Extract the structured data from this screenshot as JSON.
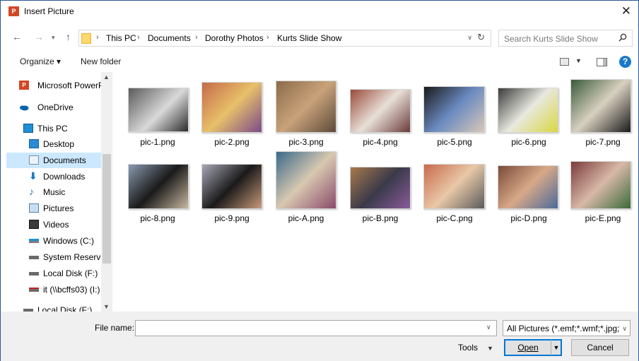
{
  "window": {
    "title": "Insert Picture",
    "app_icon_text": "P"
  },
  "address": {
    "crumbs": [
      "This PC",
      "Documents",
      "Dorothy Photos",
      "Kurts Slide Show"
    ],
    "separator": "›"
  },
  "search": {
    "placeholder": "Search Kurts Slide Show"
  },
  "toolbar": {
    "organize_label": "Organize ▾",
    "new_folder_label": "New folder"
  },
  "nav": {
    "items": [
      {
        "label": "Microsoft PowerP",
        "icon": "powerpoint-icon"
      },
      {
        "label": "OneDrive",
        "icon": "onedrive-icon"
      },
      {
        "label": "This PC",
        "icon": "computer-icon"
      },
      {
        "label": "Desktop",
        "icon": "desktop-icon"
      },
      {
        "label": "Documents",
        "icon": "documents-icon",
        "selected": true
      },
      {
        "label": "Downloads",
        "icon": "downloads-icon"
      },
      {
        "label": "Music",
        "icon": "music-icon"
      },
      {
        "label": "Pictures",
        "icon": "pictures-icon"
      },
      {
        "label": "Videos",
        "icon": "videos-icon"
      },
      {
        "label": "Windows (C:)",
        "icon": "drive-icon"
      },
      {
        "label": "System Reserved",
        "icon": "drive-icon"
      },
      {
        "label": "Local Disk (F:)",
        "icon": "drive-icon"
      },
      {
        "label": "it (\\\\bcffs03) (I:)",
        "icon": "network-drive-icon"
      },
      {
        "label": "Local Disk (F:)",
        "icon": "drive-icon"
      }
    ]
  },
  "files": [
    {
      "name": "pic-1.png",
      "colors": [
        "#5a5a5a",
        "#d9d9d9",
        "#2b2b2b"
      ]
    },
    {
      "name": "pic-2.png",
      "colors": [
        "#c46a4a",
        "#e8c06a",
        "#7a4a8a"
      ]
    },
    {
      "name": "pic-3.png",
      "colors": [
        "#8b6b4a",
        "#c9a27a",
        "#5d4a3a"
      ]
    },
    {
      "name": "pic-4.png",
      "colors": [
        "#9a4a3a",
        "#e8e0d8",
        "#6a3a3a"
      ]
    },
    {
      "name": "pic-5.png",
      "colors": [
        "#1a1a1a",
        "#6a8ac0",
        "#d8c8b8"
      ]
    },
    {
      "name": "pic-6.png",
      "colors": [
        "#3a3a3a",
        "#e8e8e0",
        "#d8d840"
      ]
    },
    {
      "name": "pic-7.png",
      "colors": [
        "#3a5a3a",
        "#d8d0c0",
        "#1a1a1a"
      ]
    },
    {
      "name": "pic-8.png",
      "colors": [
        "#8a9ab0",
        "#1a1a1a",
        "#c8b8a0"
      ]
    },
    {
      "name": "pic-9.png",
      "colors": [
        "#a8a8b8",
        "#1a1a1a",
        "#c89a7a"
      ]
    },
    {
      "name": "pic-A.png",
      "colors": [
        "#3a6a8a",
        "#d8c8b0",
        "#8a4a6a"
      ]
    },
    {
      "name": "pic-B.png",
      "colors": [
        "#a87a4a",
        "#3a3a4a",
        "#8a5a9a"
      ]
    },
    {
      "name": "pic-C.png",
      "colors": [
        "#c86a4a",
        "#e8c8a8",
        "#5a5a5a"
      ]
    },
    {
      "name": "pic-D.png",
      "colors": [
        "#7a4a3a",
        "#d8a888",
        "#4a6a9a"
      ]
    },
    {
      "name": "pic-E.png",
      "colors": [
        "#7a3a3a",
        "#d8b8a8",
        "#3a6a3a"
      ]
    }
  ],
  "bottom": {
    "file_name_label": "File name:",
    "file_name_value": "",
    "filter_label": "All Pictures (*.emf;*.wmf;*.jpg;*",
    "tools_label": "Tools",
    "open_label": "Open",
    "cancel_label": "Cancel"
  }
}
